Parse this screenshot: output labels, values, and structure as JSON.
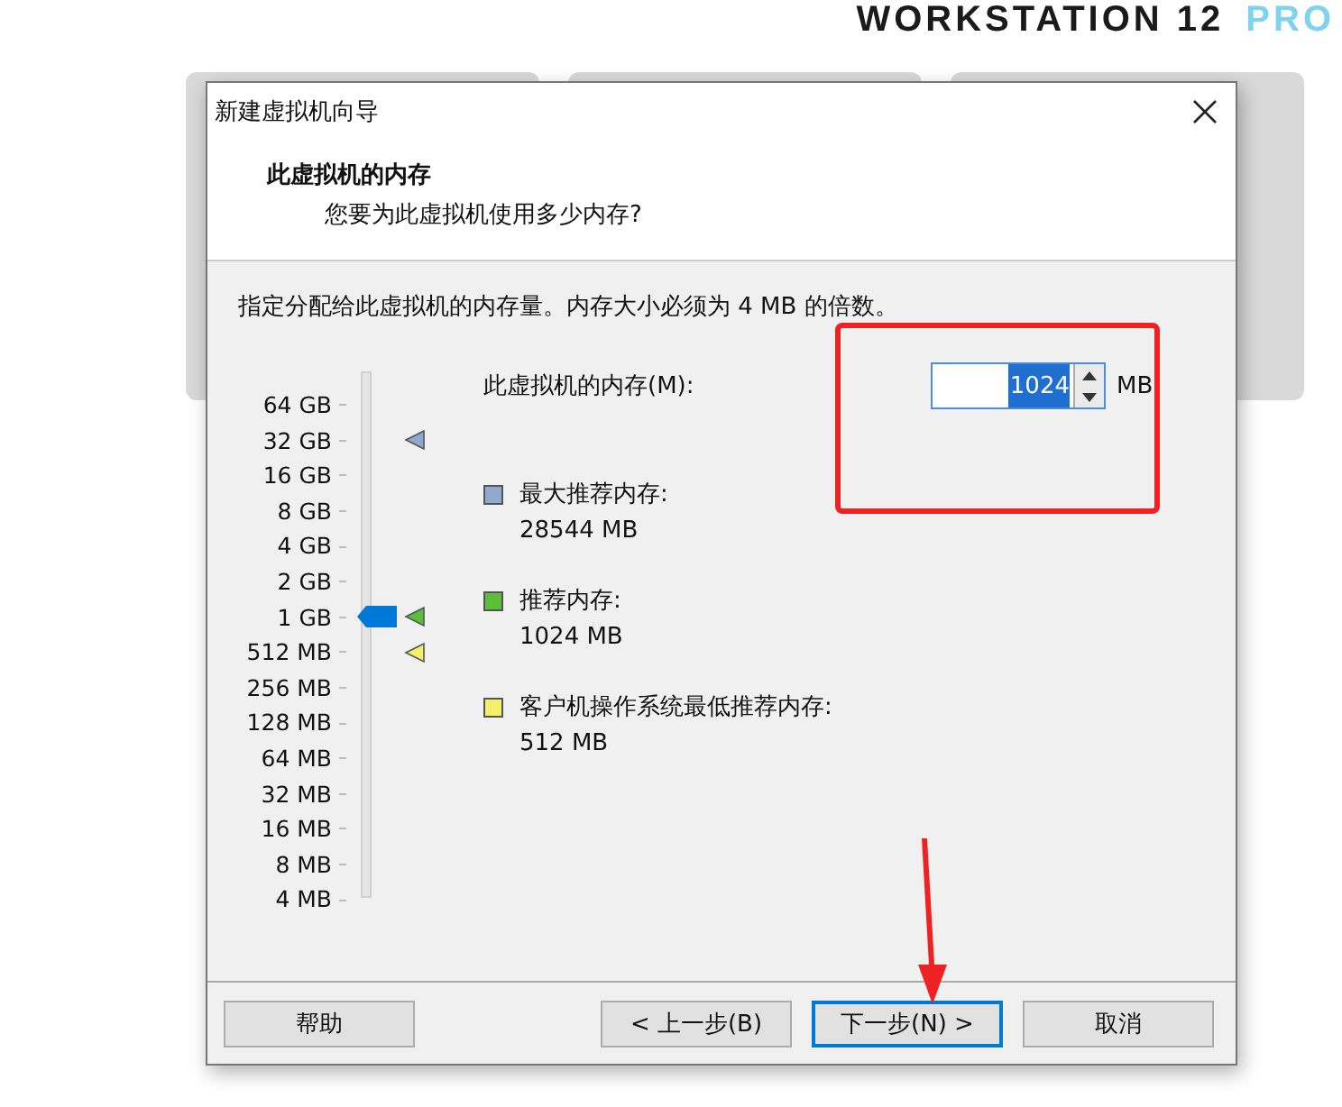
{
  "background": {
    "brand": "WORKSTATION 12",
    "brand_accent": "PRO"
  },
  "window": {
    "title": "新建虚拟机向导",
    "heading": "此虚拟机的内存",
    "subheading": "您要为此虚拟机使用多少内存?"
  },
  "instruction": "指定分配给此虚拟机的内存量。内存大小必须为 4 MB 的倍数。",
  "memory_field": {
    "label": "此虚拟机的内存(M):",
    "value": "1024",
    "unit": "MB"
  },
  "slider": {
    "level": 0.5714
  },
  "scale": [
    {
      "label": "64 GB"
    },
    {
      "label": "32 GB",
      "color": "#8fa9cf"
    },
    {
      "label": "16 GB"
    },
    {
      "label": "8 GB"
    },
    {
      "label": "4 GB"
    },
    {
      "label": "2 GB"
    },
    {
      "label": "1 GB",
      "color": "#5cbf3a"
    },
    {
      "label": "512 MB",
      "color": "#f2ef6a"
    },
    {
      "label": "256 MB"
    },
    {
      "label": "128 MB"
    },
    {
      "label": "64 MB"
    },
    {
      "label": "32 MB"
    },
    {
      "label": "16 MB"
    },
    {
      "label": "8 MB"
    },
    {
      "label": "4 MB"
    }
  ],
  "legend": [
    {
      "label": "最大推荐内存:",
      "value": "28544 MB",
      "color": "#8fa9cf"
    },
    {
      "label": "推荐内存:",
      "value": "1024 MB",
      "color": "#5cbf3a"
    },
    {
      "label": "客户机操作系统最低推荐内存:",
      "value": "512 MB",
      "color": "#f2ef6a"
    }
  ],
  "buttons": [
    {
      "label": "帮助",
      "focused": false
    },
    {
      "label": "< 上一步(B)",
      "focused": false
    },
    {
      "label": "下一步(N) >",
      "focused": true
    },
    {
      "label": "取消",
      "focused": false
    }
  ]
}
